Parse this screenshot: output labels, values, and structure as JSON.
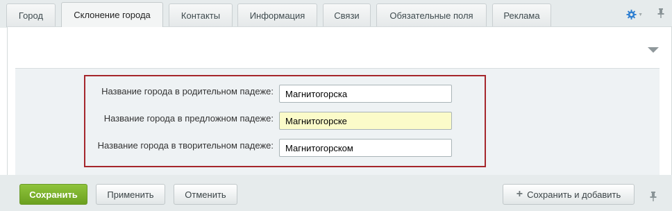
{
  "tabs": [
    {
      "label": "Город"
    },
    {
      "label": "Склонение города"
    },
    {
      "label": "Контакты"
    },
    {
      "label": "Информация"
    },
    {
      "label": "Связи"
    },
    {
      "label": "Обязательные поля"
    },
    {
      "label": "Реклама"
    }
  ],
  "active_tab": "Склонение города",
  "form": {
    "fields": [
      {
        "label": "Название города в родительном падеже:",
        "value": "Магнитогорска"
      },
      {
        "label": "Название города в предложном падеже:",
        "value": "Магнитогорске"
      },
      {
        "label": "Название города в творительном падеже:",
        "value": "Магнитогорском"
      }
    ]
  },
  "buttons": {
    "save": "Сохранить",
    "apply": "Применить",
    "cancel": "Отменить",
    "save_add": "Сохранить и добавить"
  },
  "icons": {
    "settings": "gear-icon",
    "pin": "pin-icon",
    "collapse": "triangle-down-icon",
    "add": "plus-icon"
  },
  "colors": {
    "primary_button": "#7cb32c",
    "highlight_border": "#a5262b",
    "focused_field": "#fbfbc9"
  }
}
